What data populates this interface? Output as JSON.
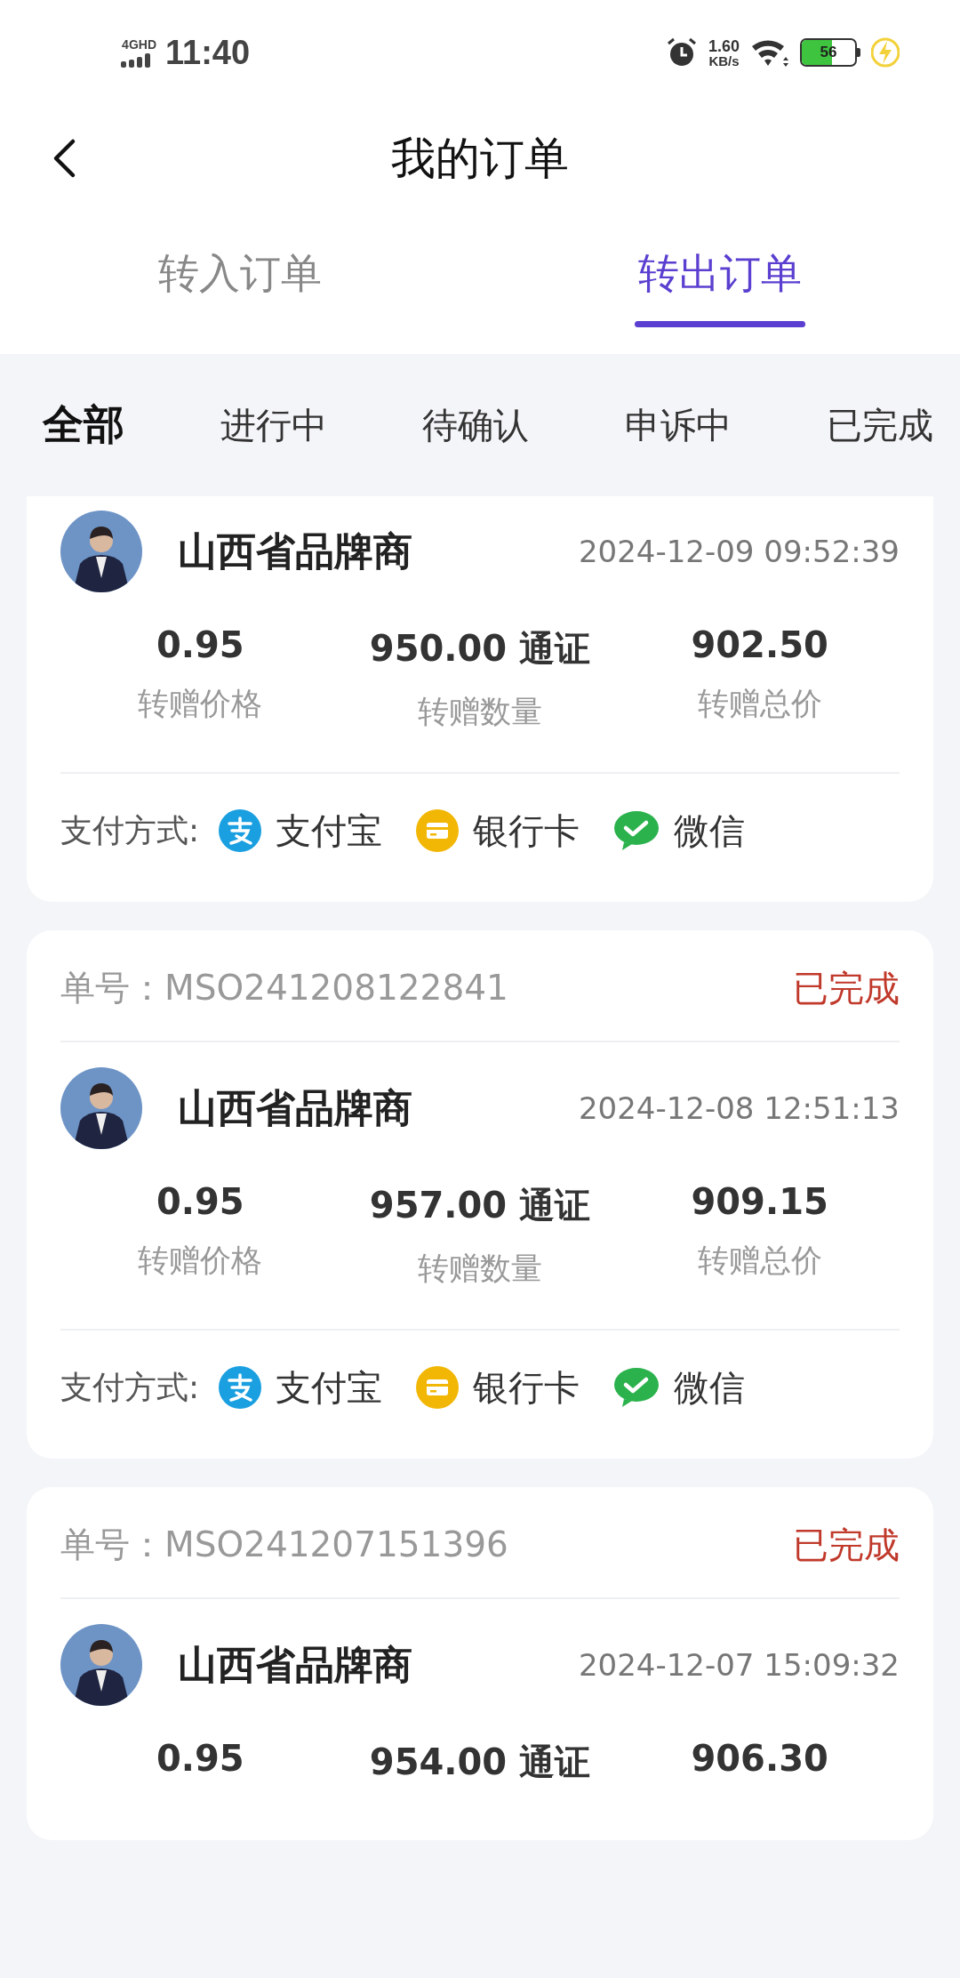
{
  "status_bar": {
    "network": "4GHD",
    "time": "11:40",
    "speed": "1.60",
    "speed_unit": "KB/s",
    "battery": "56"
  },
  "header": {
    "title": "我的订单"
  },
  "tabs": [
    {
      "label": "转入订单",
      "selected": false
    },
    {
      "label": "转出订单",
      "selected": true
    }
  ],
  "filters": [
    {
      "label": "全部",
      "selected": true
    },
    {
      "label": "进行中",
      "selected": false
    },
    {
      "label": "待确认",
      "selected": false
    },
    {
      "label": "申诉中",
      "selected": false
    },
    {
      "label": "已完成",
      "selected": false
    }
  ],
  "orders": [
    {
      "user": "山西省品牌商",
      "time": "2024-12-09 09:52:39",
      "stats": [
        {
          "value": "0.95",
          "label": "转赠价格"
        },
        {
          "value": "950.00 通证",
          "label": "转赠数量"
        },
        {
          "value": "902.50",
          "label": "转赠总价"
        }
      ],
      "payment_label": "支付方式:",
      "payments": [
        {
          "kind": "alipay",
          "label": "支付宝"
        },
        {
          "kind": "bank",
          "label": "银行卡"
        },
        {
          "kind": "wechat",
          "label": "微信"
        }
      ]
    },
    {
      "order_no": "单号：MSO241208122841",
      "status": "已完成",
      "user": "山西省品牌商",
      "time": "2024-12-08 12:51:13",
      "stats": [
        {
          "value": "0.95",
          "label": "转赠价格"
        },
        {
          "value": "957.00 通证",
          "label": "转赠数量"
        },
        {
          "value": "909.15",
          "label": "转赠总价"
        }
      ],
      "payment_label": "支付方式:",
      "payments": [
        {
          "kind": "alipay",
          "label": "支付宝"
        },
        {
          "kind": "bank",
          "label": "银行卡"
        },
        {
          "kind": "wechat",
          "label": "微信"
        }
      ]
    },
    {
      "order_no": "单号：MSO241207151396",
      "status": "已完成",
      "user": "山西省品牌商",
      "time": "2024-12-07 15:09:32",
      "stats": [
        {
          "value": "0.95"
        },
        {
          "value": "954.00 通证"
        },
        {
          "value": "906.30"
        }
      ]
    }
  ]
}
